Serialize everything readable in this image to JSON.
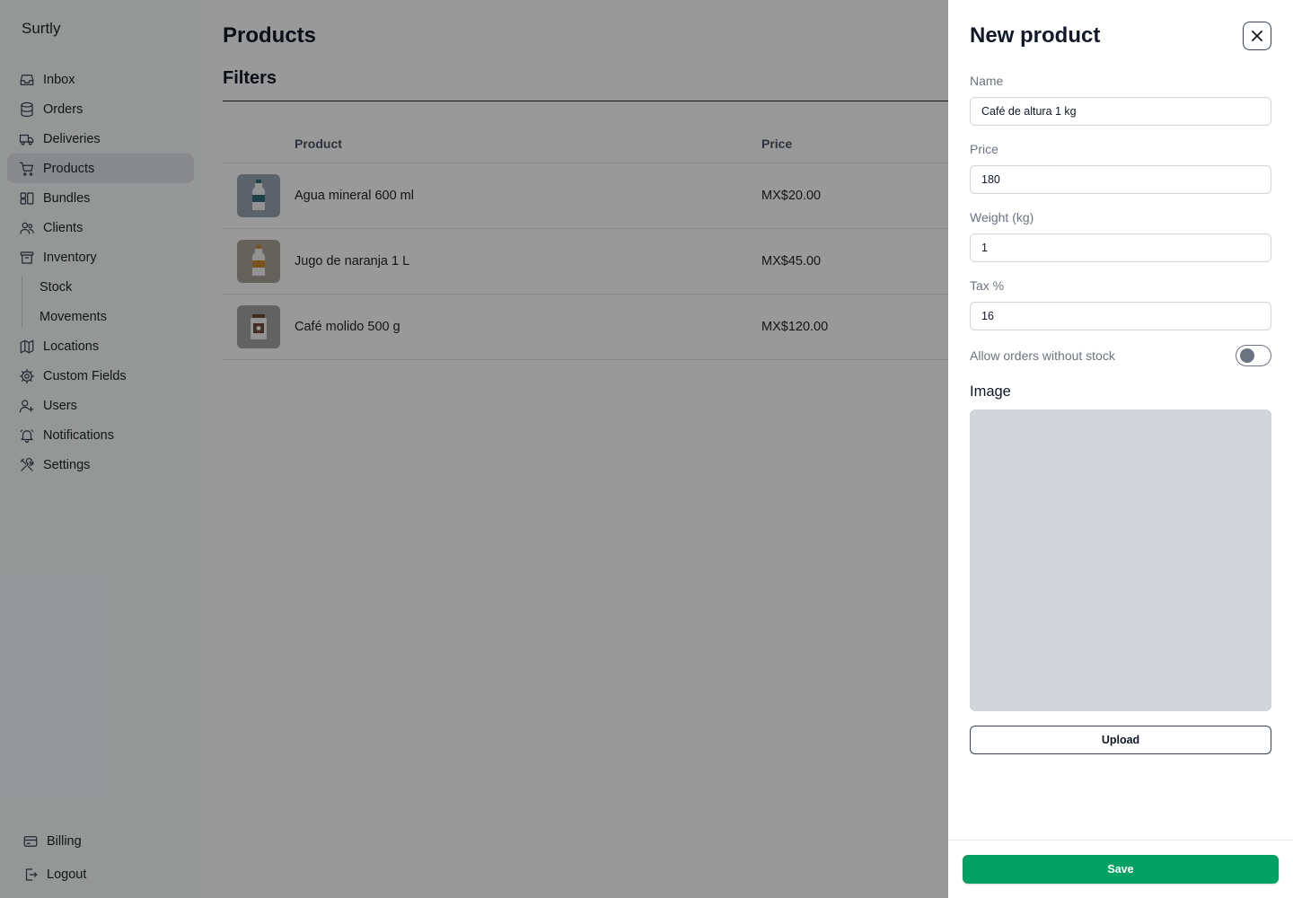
{
  "brand": {
    "name": "Surtly"
  },
  "sidebar": {
    "items": [
      {
        "label": "Inbox",
        "icon": "inbox-icon"
      },
      {
        "label": "Orders",
        "icon": "database-icon"
      },
      {
        "label": "Deliveries",
        "icon": "truck-icon"
      },
      {
        "label": "Products",
        "icon": "cart-icon",
        "active": true
      },
      {
        "label": "Bundles",
        "icon": "bundles-icon"
      },
      {
        "label": "Clients",
        "icon": "users-icon"
      },
      {
        "label": "Inventory",
        "icon": "archive-icon"
      }
    ],
    "inventory_sub": [
      {
        "label": "Stock"
      },
      {
        "label": "Movements"
      }
    ],
    "items_after": [
      {
        "label": "Locations",
        "icon": "map-icon"
      },
      {
        "label": "Custom Fields",
        "icon": "cog-icon"
      },
      {
        "label": "Users",
        "icon": "user-plus-icon"
      },
      {
        "label": "Notifications",
        "icon": "bell-icon"
      },
      {
        "label": "Settings",
        "icon": "tools-icon"
      }
    ],
    "bottom": [
      {
        "label": "Billing",
        "icon": "credit-card-icon"
      },
      {
        "label": "Logout",
        "icon": "logout-icon"
      }
    ]
  },
  "main": {
    "title": "Products",
    "filters_title": "Filters",
    "table": {
      "columns": [
        "Product",
        "Price"
      ],
      "rows": [
        {
          "name": "Agua mineral 600 ml",
          "price": "MX$20.00",
          "thumb_color": "#9aa4b1",
          "label_color": "#2f6b73"
        },
        {
          "name": "Jugo de naranja 1 L",
          "price": "MX$45.00",
          "thumb_color": "#a8a39c",
          "label_color": "#c9892e"
        },
        {
          "name": "Café molido 500 g",
          "price": "MX$120.00",
          "thumb_color": "#a3a3a3",
          "label_color": "#6b4a36"
        }
      ]
    }
  },
  "drawer": {
    "title": "New product",
    "fields": {
      "name": {
        "label": "Name",
        "value": "Café de altura 1 kg"
      },
      "price": {
        "label": "Price",
        "value": "180"
      },
      "weight": {
        "label": "Weight (kg)",
        "value": "1"
      },
      "tax": {
        "label": "Tax %",
        "value": "16"
      }
    },
    "allow_orders": {
      "label": "Allow orders without stock",
      "enabled": false
    },
    "image_title": "Image",
    "upload_label": "Upload",
    "save_label": "Save"
  },
  "colors": {
    "accent": "#03a064",
    "overlay": "rgba(0,0,0,0.40)",
    "sidebar_bg": "#f9fafb"
  }
}
